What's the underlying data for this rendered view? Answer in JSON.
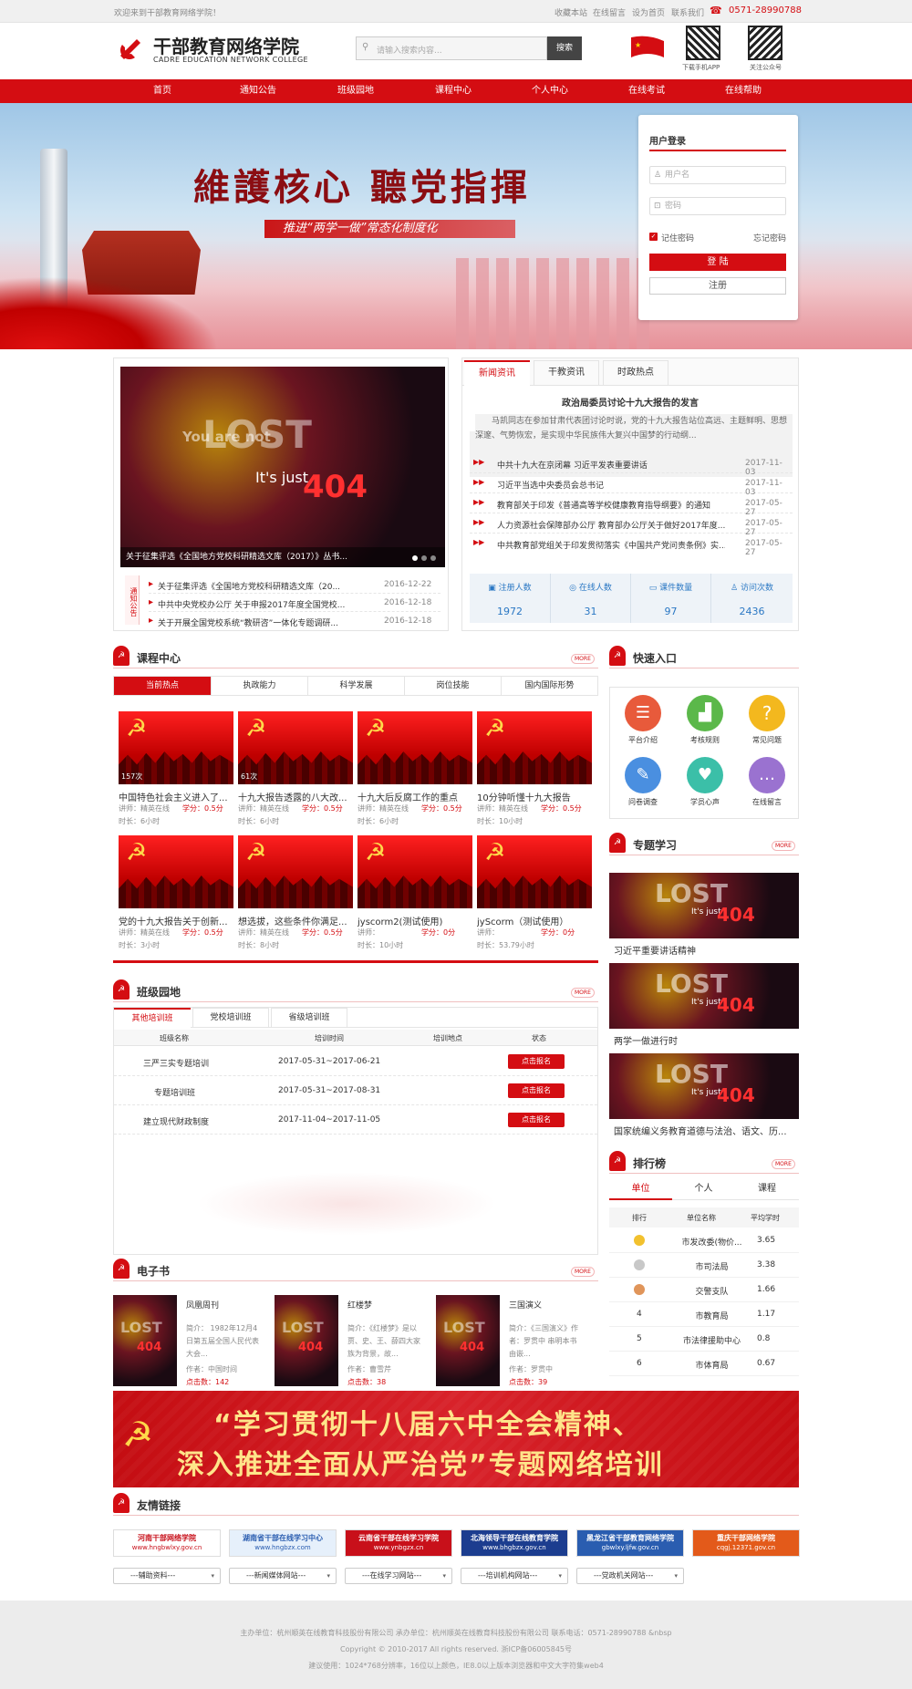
{
  "topbar": {
    "welcome": "欢迎来到干部教育网络学院！",
    "links": [
      "收藏本站",
      "在线留言",
      "设为首页",
      "联系我们"
    ],
    "phone": "0571-28990788"
  },
  "header": {
    "title": "干部教育网络学院",
    "subtitle": "CADRE EDUCATION NETWORK COLLEGE",
    "search_placeholder": "请输入搜索内容...",
    "search_btn": "搜索",
    "qr1": "下载手机APP",
    "qr2": "关注公众号"
  },
  "nav": [
    "首页",
    "通知公告",
    "班级园地",
    "课程中心",
    "个人中心",
    "在线考试",
    "在线帮助"
  ],
  "banner": {
    "slogan": "維護核心 聽党指揮",
    "sub": "推进“两学一做”常态化制度化"
  },
  "login": {
    "title": "用户登录",
    "user_ph": "用户名",
    "pass_ph": "密码",
    "remember": "记住密码",
    "forgot": "忘记密码",
    "login_btn": "登 陆",
    "register_btn": "注册"
  },
  "slider": {
    "text1": "You are not",
    "text2": "LOST",
    "text3": "It's just",
    "text4": "404",
    "caption": "关于征集评选《全国地方党校科研精选文库（2017）》丛书..."
  },
  "notice": {
    "label": "通知公告",
    "items": [
      {
        "title": "关于征集评选《全国地方党校科研精选文库（20...",
        "date": "2016-12-22"
      },
      {
        "title": "中共中央党校办公厅 关于申报2017年度全国党校...",
        "date": "2016-12-18"
      },
      {
        "title": "关于开展全国党校系统“教研咨”一体化专题调研...",
        "date": "2016-12-18"
      }
    ]
  },
  "news": {
    "tabs": [
      "新闻资讯",
      "干教资讯",
      "时政热点"
    ],
    "headline": "政治局委员讨论十九大报告的发言",
    "summary": "马凯同志在参加甘肃代表团讨论时说，党的十九大报告站位高远、主题鲜明、思想深邃、气势恢宏，是实现中华民族伟大复兴中国梦的行动纲...",
    "items": [
      {
        "title": "中共十九大在京闭幕 习近平发表重要讲话",
        "date": "2017-11-03"
      },
      {
        "title": "习近平当选中央委员会总书记",
        "date": "2017-11-03"
      },
      {
        "title": "教育部关于印发《普通高等学校健康教育指导纲要》的通知",
        "date": "2017-05-27"
      },
      {
        "title": "人力资源社会保障部办公厅 教育部办公厅关于做好2017年度...",
        "date": "2017-05-27"
      },
      {
        "title": "中共教育部党组关于印发贯彻落实《中国共产党问责条例》实...",
        "date": "2017-05-27"
      }
    ],
    "stats": [
      {
        "label": "注册人数",
        "value": "1972"
      },
      {
        "label": "在线人数",
        "value": "31"
      },
      {
        "label": "课件数量",
        "value": "97"
      },
      {
        "label": "访问次数",
        "value": "2436"
      }
    ]
  },
  "course": {
    "title": "课程中心",
    "more": "MORE",
    "tabs": [
      "当前热点",
      "执政能力",
      "科学发展",
      "岗位技能",
      "国内国际形势"
    ],
    "items": [
      {
        "title": "中国特色社会主义进入了...",
        "views": "157次",
        "teacher": "讲师：精英在线",
        "credit": "学分：0.5分",
        "duration": "时长：6小时"
      },
      {
        "title": "十九大报告透露的八大改...",
        "views": "61次",
        "teacher": "讲师：精英在线",
        "credit": "学分：0.5分",
        "duration": "时长：6小时"
      },
      {
        "title": "十九大后反腐工作的重点",
        "views": "",
        "teacher": "讲师：精英在线",
        "credit": "学分：0.5分",
        "duration": "时长：6小时"
      },
      {
        "title": "10分钟听懂十九大报告",
        "views": "",
        "teacher": "讲师：精英在线",
        "credit": "学分：0.5分",
        "duration": "时长：10小时"
      },
      {
        "title": "党的十九大报告关于创新...",
        "views": "",
        "teacher": "讲师：精英在线",
        "credit": "学分：0.5分",
        "duration": "时长：3小时"
      },
      {
        "title": "想选拔，这些条件你满足...",
        "views": "",
        "teacher": "讲师：精英在线",
        "credit": "学分：0.5分",
        "duration": "时长：8小时"
      },
      {
        "title": "jyscorm2(测试使用)",
        "views": "",
        "teacher": "讲师：",
        "credit": "学分：0分",
        "duration": "时长：10小时"
      },
      {
        "title": "jyScorm（测试使用）",
        "views": "",
        "teacher": "讲师：",
        "credit": "学分：0分",
        "duration": "时长：53.79小时"
      }
    ]
  },
  "quick": {
    "title": "快速入口",
    "items": [
      "平台介绍",
      "考核规则",
      "常见问题",
      "问卷调查",
      "学员心声",
      "在线留言"
    ]
  },
  "topic": {
    "title": "专题学习",
    "more": "MORE",
    "items": [
      "习近平重要讲话精神",
      "两学一做进行时",
      "国家统编义务教育道德与法治、语文、历..."
    ]
  },
  "classes": {
    "title": "班级园地",
    "more": "MORE",
    "tabs": [
      "其他培训班",
      "党校培训班",
      "省级培训班"
    ],
    "headers": [
      "班级名称",
      "培训时间",
      "培训地点",
      "状态"
    ],
    "rows": [
      {
        "name": "三严三实专题培训",
        "time": "2017-05-31~2017-06-21",
        "place": "",
        "btn": "点击报名"
      },
      {
        "name": "专题培训班",
        "time": "2017-05-31~2017-08-31",
        "place": "",
        "btn": "点击报名"
      },
      {
        "name": "建立现代财政制度",
        "time": "2017-11-04~2017-11-05",
        "place": "",
        "btn": "点击报名"
      }
    ]
  },
  "rank": {
    "title": "排行榜",
    "more": "MORE",
    "tabs": [
      "单位",
      "个人",
      "课程"
    ],
    "headers": [
      "排行",
      "单位名称",
      "平均学时"
    ],
    "rows": [
      {
        "rank": "",
        "name": "市发改委(物价...",
        "value": "3.65"
      },
      {
        "rank": "",
        "name": "市司法局",
        "value": "3.38"
      },
      {
        "rank": "",
        "name": "交警支队",
        "value": "1.66"
      },
      {
        "rank": "4",
        "name": "市教育局",
        "value": "1.17"
      },
      {
        "rank": "5",
        "name": "市法律援助中心",
        "value": "0.8"
      },
      {
        "rank": "6",
        "name": "市体育局",
        "value": "0.67"
      }
    ]
  },
  "ebook": {
    "title": "电子书",
    "more": "MORE",
    "items": [
      {
        "title": "凤凰周刊",
        "intro": "简介： 1982年12月4日第五届全国人民代表大会...",
        "author": "作者：中国时间",
        "clicks": "点击数：142"
      },
      {
        "title": "红楼梦",
        "intro": "简介：《红楼梦》是以贾、史、王、薛四大家族为背景，故...",
        "author": "作者：曹雪芹",
        "clicks": "点击数：38"
      },
      {
        "title": "三国演义",
        "intro": "简介：《三国演义》作者：罗贯中 串明本书由嵌...",
        "author": "作者：罗贯中",
        "clicks": "点击数：39"
      }
    ]
  },
  "promo": {
    "line1": "“学习贯彻十八届六中全会精神、",
    "line2": "深入推进全面从严治党”专题网络培训"
  },
  "links": {
    "title": "友情链接",
    "logos": [
      {
        "name": "河南干部网络学院",
        "url": "www.hngbwlxy.gov.cn"
      },
      {
        "name": "湖南省干部在线学习中心",
        "url": "www.hngbzx.com"
      },
      {
        "name": "云南省干部在线学习学院",
        "url": "www.ynbgzx.cn"
      },
      {
        "name": "北海领导干部在线教育学院",
        "url": "www.bhgbzx.gov.cn"
      },
      {
        "name": "黑龙江省干部教育网络学院",
        "url": "gbwlxy.ljfw.gov.cn"
      },
      {
        "name": "重庆干部网络学院",
        "url": "cqgj.12371.gov.cn"
      }
    ],
    "selects": [
      "---辅助资料---",
      "---新闻媒体网站---",
      "---在线学习网站---",
      "---培训机构网站---",
      "---党政机关网站---"
    ]
  },
  "footer": {
    "line1": "主办单位：杭州顺英在线教育科技股份有限公司    承办单位：杭州顺英在线教育科技股份有限公司    联系电话：0571-28990788  &nbsp",
    "line2": "Copyright © 2010-2017 All rights reserved. 浙ICP备06005845号",
    "line3": "建议使用：1024*768分辨率，16位以上颜色，IE8.0以上版本浏览器和中文大字符集web4"
  },
  "colors": {
    "primary": "#d40d12",
    "nav": "#d40d12",
    "link": "#2b78c4"
  }
}
